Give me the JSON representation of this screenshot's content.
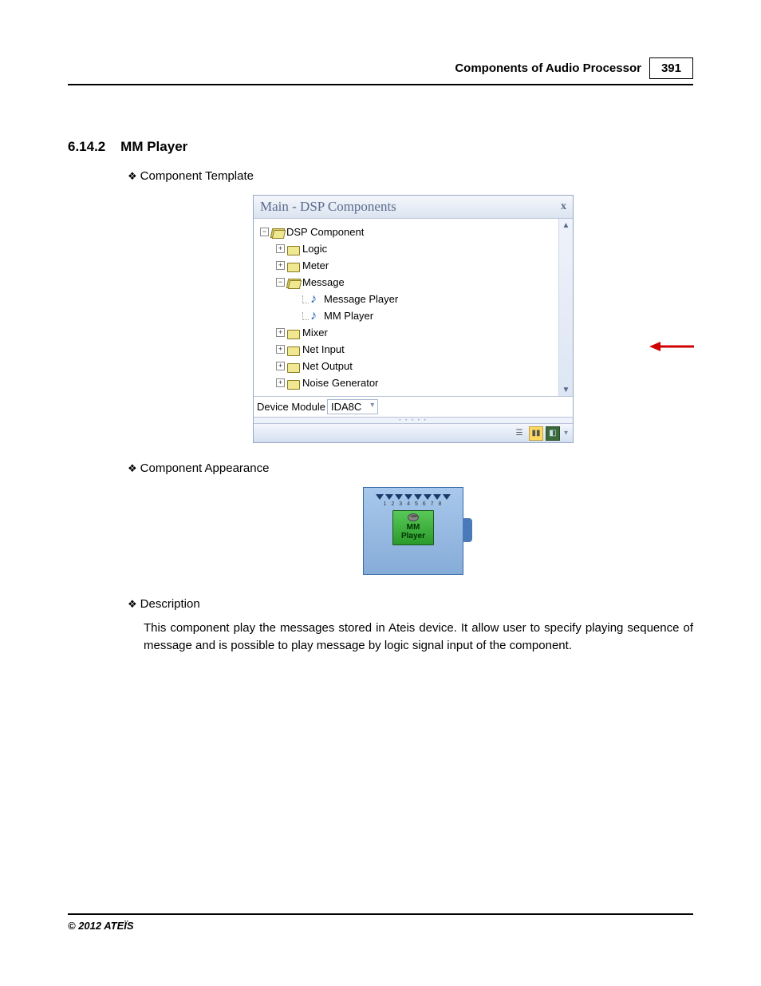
{
  "header": {
    "title": "Components of Audio Processor",
    "page_number": "391"
  },
  "section": {
    "number": "6.14.2",
    "title": "MM Player"
  },
  "bullets": {
    "b1": "Component Template",
    "b2": "Component Appearance",
    "b3": "Description"
  },
  "panel": {
    "title": "Main - DSP Components",
    "tree": {
      "root": "DSP Component",
      "items": {
        "logic": "Logic",
        "meter": "Meter",
        "message": "Message",
        "message_player": "Message Player",
        "mm_player": "MM Player",
        "mixer": "Mixer",
        "net_input": "Net Input",
        "net_output": "Net Output",
        "noise_generator": "Noise Generator"
      }
    },
    "device_label": "Device Module",
    "device_value": "IDA8C"
  },
  "appearance": {
    "line1": "MM",
    "line2": "Player"
  },
  "description": "This component play the messages stored in Ateis device. It allow user to specify playing sequence of message and is possible to play message by logic signal input of the component.",
  "footer": "© 2012 ATEÏS"
}
